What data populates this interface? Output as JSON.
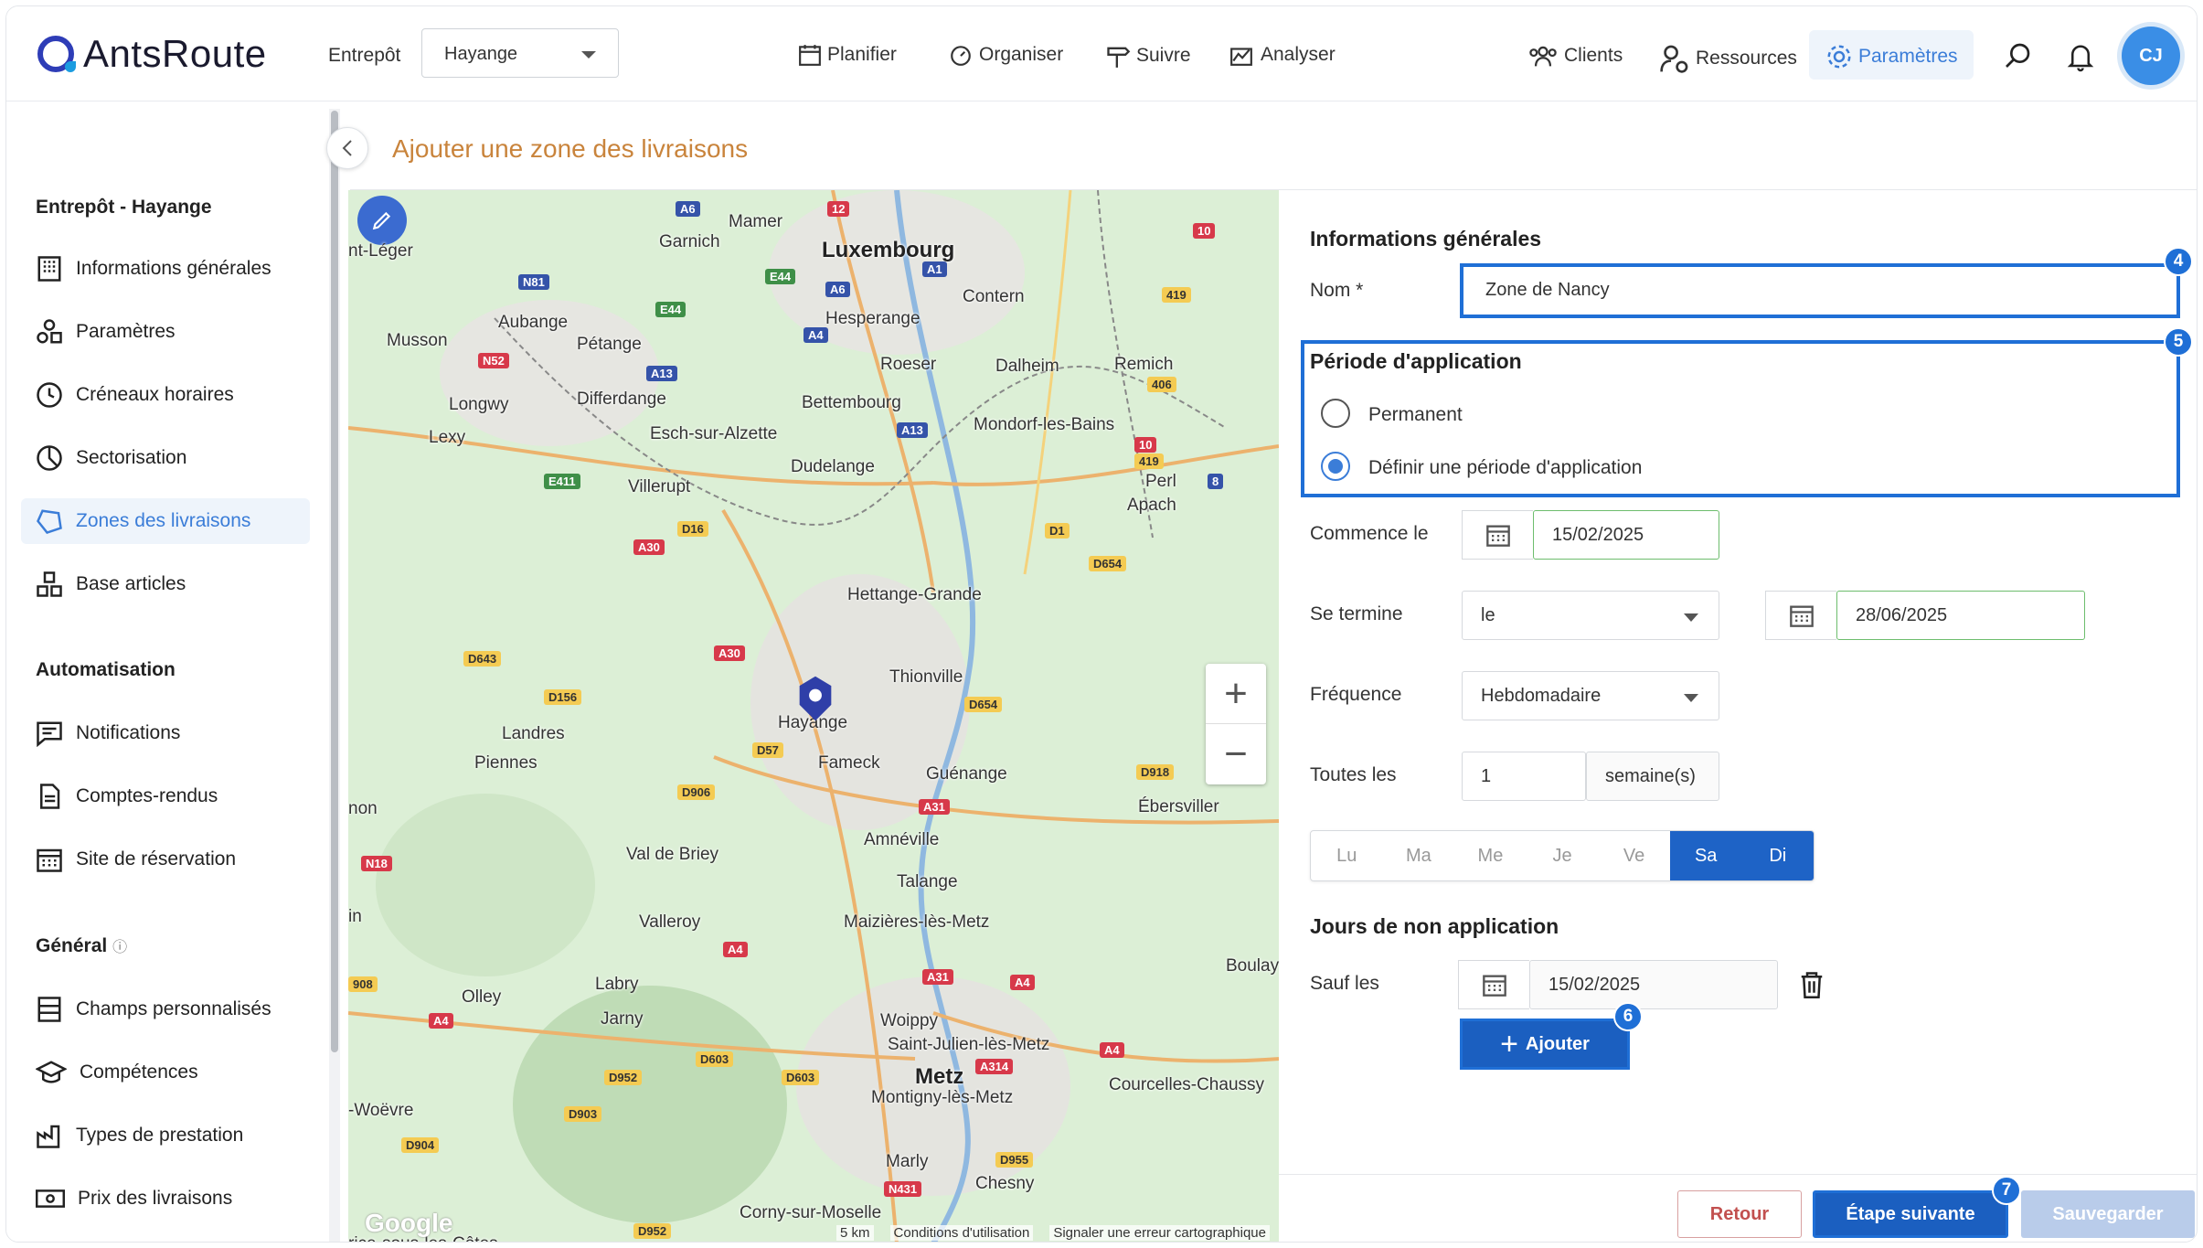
{
  "app": {
    "logo": "AntsRoute"
  },
  "header": {
    "warehouse_label": "Entrepôt",
    "warehouse_value": "Hayange",
    "nav": [
      "Planifier",
      "Organiser",
      "Suivre",
      "Analyser"
    ],
    "right_nav": [
      "Clients",
      "Ressources",
      "Paramètres"
    ],
    "avatar": "CJ"
  },
  "sidebar": {
    "section1": "Entrepôt - Hayange",
    "items1": [
      "Informations générales",
      "Paramètres",
      "Créneaux horaires",
      "Sectorisation",
      "Zones des livraisons",
      "Base articles"
    ],
    "section2": "Automatisation",
    "items2": [
      "Notifications",
      "Comptes-rendus",
      "Site de réservation"
    ],
    "section3": "Général",
    "items3": [
      "Champs personnalisés",
      "Compétences",
      "Types de prestation",
      "Prix des livraisons"
    ]
  },
  "page": {
    "title": "Ajouter une zone des livraisons"
  },
  "map": {
    "places": [
      "Mamer",
      "Luxembourg",
      "Garnich",
      "nt-Léger",
      "Contern",
      "Aubange",
      "Hesperange",
      "Musson",
      "Pétange",
      "Roeser",
      "Dalheim",
      "Remich",
      "Longwy",
      "Differdange",
      "Bettembourg",
      "Lexy",
      "Esch-sur-Alzette",
      "Mondorf-les-Bains",
      "Dudelange",
      "Villerupt",
      "Perl",
      "Apach",
      "Hettange-Grande",
      "Thionville",
      "Hayange",
      "Landres",
      "Fameck",
      "Guénange",
      "Piennes",
      "Ébersviller",
      "non",
      "Val de Briey",
      "Amnéville",
      "Talange",
      "Valleroy",
      "Maizières-lès-Metz",
      "in",
      "Boulay",
      "Labry",
      "Olley",
      "Jarny",
      "Woippy",
      "Saint-Julien-lès-Metz",
      "Metz",
      "Courcelles-Chaussy",
      "Montigny-lès-Metz",
      "-Woëvre",
      "Marly",
      "Chesny",
      "Corny-sur-Moselle",
      "rice-sous-les-Côtes"
    ],
    "roads": [
      "A6",
      "A1",
      "E44",
      "N81",
      "E44",
      "A6",
      "A4",
      "N52",
      "A13",
      "A13",
      "E411",
      "A30",
      "D16",
      "D1",
      "D654",
      "A30",
      "D643",
      "D156",
      "D57",
      "D906",
      "D654",
      "A31",
      "D918",
      "N18",
      "A4",
      "A31",
      "A4",
      "D603",
      "D952",
      "D603",
      "A314",
      "A4",
      "D903",
      "D904",
      "D955",
      "N431",
      "D952",
      "12",
      "10",
      "419",
      "406",
      "10",
      "419",
      "8",
      "908",
      "A4"
    ],
    "google": "Google",
    "footer": [
      "5 km",
      "Conditions d'utilisation",
      "Signaler une erreur cartographique"
    ]
  },
  "form": {
    "section_general": "Informations générales",
    "name_label": "Nom *",
    "name_value": "Zone de Nancy",
    "period_title": "Période d'application",
    "radio_permanent": "Permanent",
    "radio_define": "Définir une période d'application",
    "starts_label": "Commence le",
    "starts_value": "15/02/2025",
    "ends_label": "Se termine",
    "ends_mode": "le",
    "ends_value": "28/06/2025",
    "frequency_label": "Fréquence",
    "frequency_value": "Hebdomadaire",
    "every_label": "Toutes les",
    "every_value": "1",
    "every_unit": "semaine(s)",
    "days": [
      "Lu",
      "Ma",
      "Me",
      "Je",
      "Ve",
      "Sa",
      "Di"
    ],
    "non_app_title": "Jours de non application",
    "except_label": "Sauf les",
    "except_value": "15/02/2025",
    "add_button": "Ajouter",
    "back_button": "Retour",
    "next_button": "Étape suivante",
    "save_button": "Sauvegarder",
    "badges": [
      "4",
      "5",
      "6",
      "7"
    ]
  }
}
